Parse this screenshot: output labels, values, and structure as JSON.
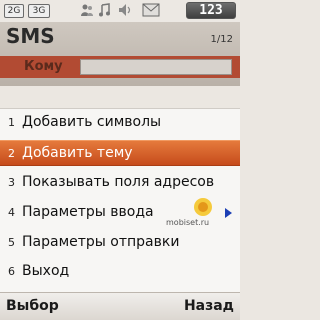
{
  "status_bar": {
    "network_label": "2G",
    "mode_label": "3G",
    "icons": [
      "people-icon",
      "music-note-icon",
      "volume-icon",
      "message-icon"
    ],
    "battery_text": "123"
  },
  "background_screen": {
    "title": "SMS",
    "counter": "1/12",
    "to_label": "Кому"
  },
  "menu": {
    "selected_index": 1,
    "items": [
      {
        "number": "1",
        "label": "Добавить символы",
        "has_submenu": false
      },
      {
        "number": "2",
        "label": "Добавить тему",
        "has_submenu": false
      },
      {
        "number": "3",
        "label": "Показывать поля адресов",
        "has_submenu": false
      },
      {
        "number": "4",
        "label": "Параметры ввода",
        "has_submenu": true
      },
      {
        "number": "5",
        "label": "Параметры отправки",
        "has_submenu": false
      },
      {
        "number": "6",
        "label": "Выход",
        "has_submenu": false
      }
    ]
  },
  "watermark": "mobiset.ru",
  "softkeys": {
    "left": "Выбор",
    "right": "Назад"
  },
  "colors": {
    "highlight": "#d9622b",
    "submenu_arrow": "#1c3fb5",
    "to_row": "#b24b33"
  }
}
